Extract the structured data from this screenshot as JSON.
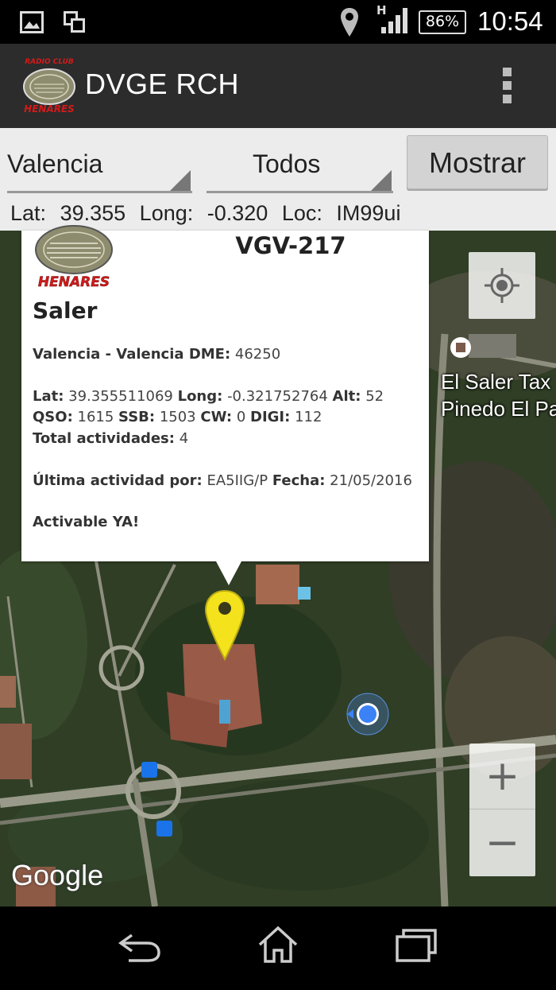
{
  "status_bar": {
    "network_type": "H",
    "battery": "86%",
    "time": "10:54"
  },
  "app": {
    "logo_top_text": "RADIO CLUB",
    "logo_bottom_text": "HENARES",
    "title": "DVGE RCH"
  },
  "filters": {
    "province": "Valencia",
    "type": "Todos",
    "show_button": "Mostrar"
  },
  "location": {
    "lat_label": "Lat:",
    "lat_value": "39.355",
    "long_label": "Long:",
    "long_value": "-0.320",
    "loc_label": "Loc:",
    "loc_value": "IM99ui"
  },
  "info_window": {
    "logo_text": "HENARES",
    "code": "VGV-217",
    "name": "Saler",
    "area_label": "Valencia - Valencia DME:",
    "area_value": "46250",
    "lat_label": "Lat:",
    "lat_value": "39.355511069",
    "long_label": "Long:",
    "long_value": "-0.321752764",
    "alt_label": "Alt:",
    "alt_value": "52",
    "qso_label": "QSO:",
    "qso_value": "1615",
    "ssb_label": "SSB:",
    "ssb_value": "1503",
    "cw_label": "CW:",
    "cw_value": "0",
    "digi_label": "DIGI:",
    "digi_value": "112",
    "total_label": "Total actividades:",
    "total_value": "4",
    "last_label": "Última actividad por:",
    "last_value": "EA5IIG/P",
    "date_label": "Fecha:",
    "date_value": "21/05/2016",
    "status": "Activable YA!"
  },
  "map": {
    "poi_line1": "El Saler Tax",
    "poi_line2": "Pinedo El Pa",
    "attribution": "Google",
    "zoom_in": "+",
    "zoom_out": "−",
    "marker_color": "#f4e21c",
    "my_location_color": "#3b82f6"
  }
}
